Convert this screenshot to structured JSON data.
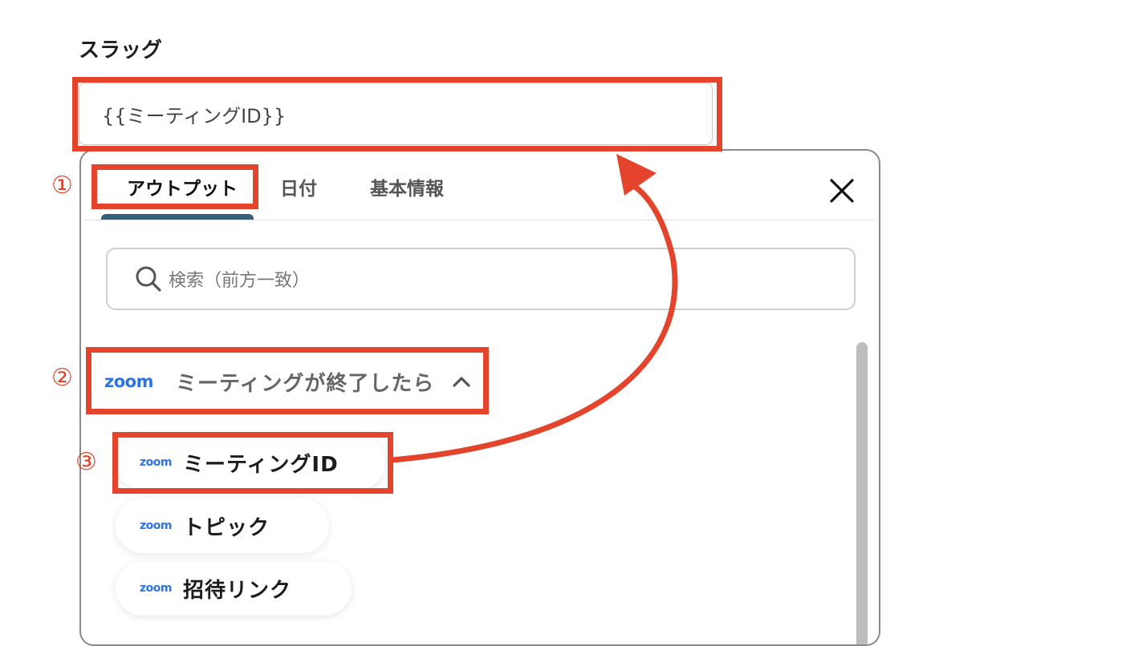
{
  "field": {
    "label": "スラッグ",
    "value": "{{ミーティングID}}"
  },
  "tabs": [
    {
      "label": "アウトプット",
      "active": true
    },
    {
      "label": "日付",
      "active": false
    },
    {
      "label": "基本情報",
      "active": false
    }
  ],
  "close_icon": "close-icon",
  "search": {
    "placeholder": "検索（前方一致）",
    "icon": "search-icon"
  },
  "group": {
    "logo": "zoom",
    "title": "ミーティングが終了したら",
    "icon": "chevron-up-icon"
  },
  "items": [
    {
      "logo": "zoom",
      "label": "ミーティングID"
    },
    {
      "logo": "zoom",
      "label": "トピック"
    },
    {
      "logo": "zoom",
      "label": "招待リンク"
    }
  ],
  "annotations": {
    "step1": "①",
    "step2": "②",
    "step3": "③",
    "color": "#e5442c"
  },
  "colors": {
    "accent": "#34607a",
    "zoom_brand": "#2d73e8"
  }
}
